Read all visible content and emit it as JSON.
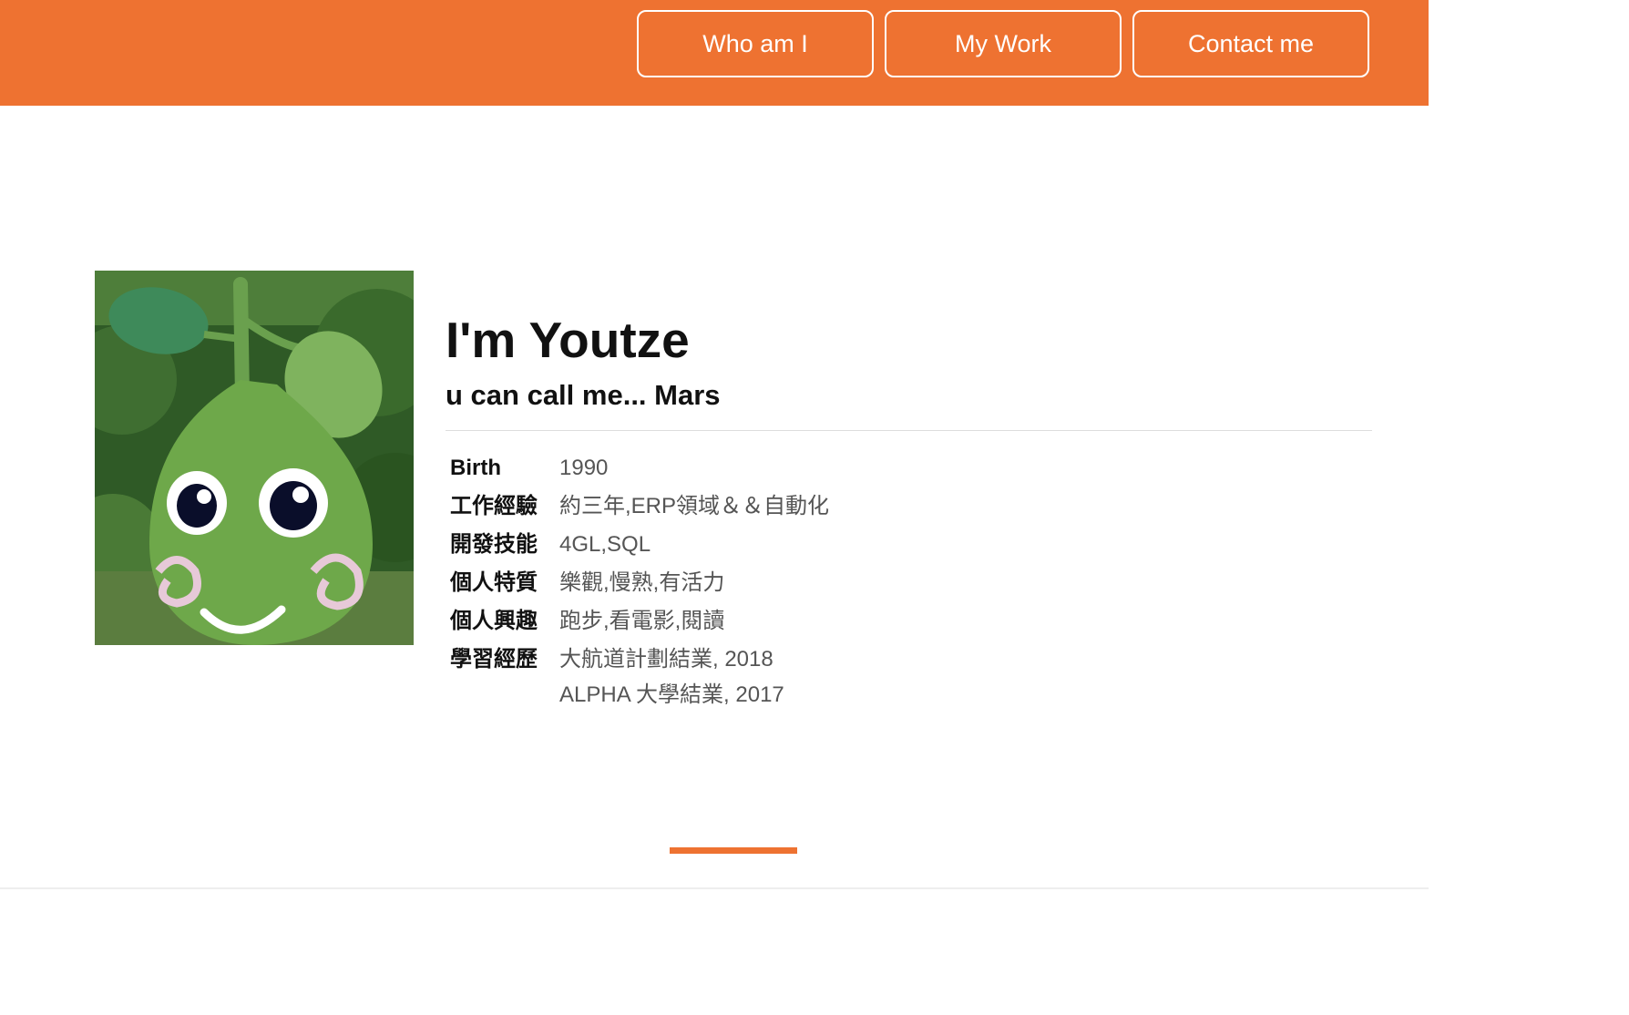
{
  "nav": {
    "items": [
      {
        "label": "Who am I"
      },
      {
        "label": "My Work"
      },
      {
        "label": "Contact me"
      }
    ]
  },
  "profile": {
    "title": "I'm Youtze",
    "subtitle": "u can call me... Mars",
    "photo_alt": "green pomelo mascot statue",
    "rows": [
      {
        "label": "Birth",
        "values": [
          "1990"
        ]
      },
      {
        "label": "工作經驗",
        "values": [
          "約三年,ERP領域＆＆自動化"
        ]
      },
      {
        "label": "開發技能",
        "values": [
          "4GL,SQL"
        ]
      },
      {
        "label": "個人特質",
        "values": [
          "樂觀,慢熟,有活力"
        ]
      },
      {
        "label": "個人興趣",
        "values": [
          "跑步,看電影,閱讀"
        ]
      },
      {
        "label": "學習經歷",
        "values": [
          "大航道計劃結業, 2018",
          "ALPHA 大學結業, 2017"
        ]
      }
    ]
  },
  "colors": {
    "accent": "#ee7231",
    "text_dark": "#111111",
    "text_muted": "#555555"
  }
}
